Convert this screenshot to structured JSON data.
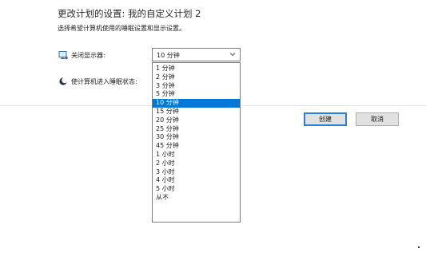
{
  "header": {
    "title": "更改计划的设置: 我的自定义计划 2",
    "subtitle": "选择希望计算机使用的睡眠设置和显示设置。"
  },
  "settings": {
    "display": {
      "icon": "monitor-icon",
      "label": "关闭显示器:",
      "selected": "10 分钟"
    },
    "sleep": {
      "icon": "moon-icon",
      "label": "使计算机进入睡眠状态:"
    }
  },
  "dropdown": {
    "options": [
      "1 分钟",
      "2 分钟",
      "3 分钟",
      "5 分钟",
      "10 分钟",
      "15 分钟",
      "20 分钟",
      "25 分钟",
      "30 分钟",
      "45 分钟",
      "1 小时",
      "2 小时",
      "3 小时",
      "4 小时",
      "5 小时",
      "从不"
    ],
    "selected_index": 4
  },
  "buttons": {
    "create": "创建",
    "cancel": "取消"
  },
  "colors": {
    "accent": "#0078d7",
    "focus_border": "#2c7fd6"
  }
}
